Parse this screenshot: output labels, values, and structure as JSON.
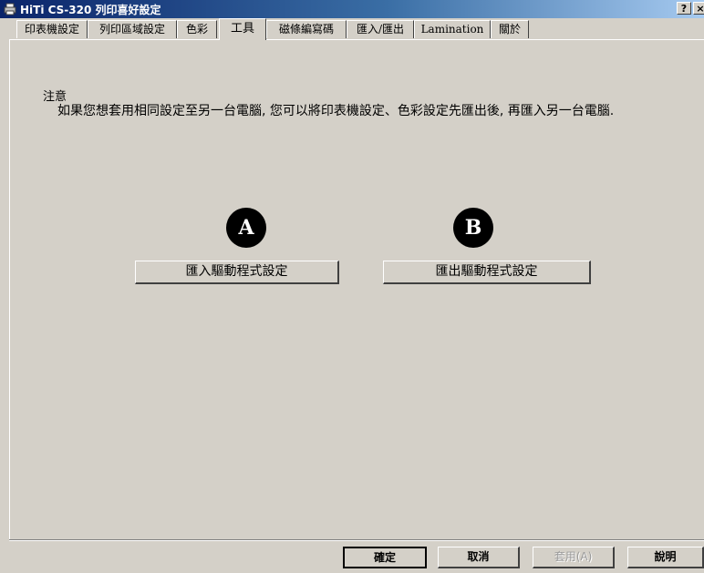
{
  "window": {
    "title": "HiTi CS-320 列印喜好設定",
    "help_button": "?",
    "close_button": "×"
  },
  "tabs": [
    {
      "label": "印表機設定"
    },
    {
      "label": "列印區域設定"
    },
    {
      "label": "色彩"
    },
    {
      "label": "工具",
      "active": true
    },
    {
      "label": "磁條編寫碼"
    },
    {
      "label": "匯入/匯出"
    },
    {
      "label": "Lamination"
    },
    {
      "label": "關於"
    }
  ],
  "content": {
    "note_title": "注意",
    "note_body": "如果您想套用相同設定至另一台電腦, 您可以將印表機設定、色彩設定先匯出後, 再匯入另一台電腦.",
    "marker_a": "A",
    "marker_b": "B",
    "import_button": "匯入驅動程式設定",
    "export_button": "匯出驅動程式設定"
  },
  "footer": {
    "ok": "確定",
    "cancel": "取消",
    "apply": "套用(A)",
    "help": "說明"
  }
}
